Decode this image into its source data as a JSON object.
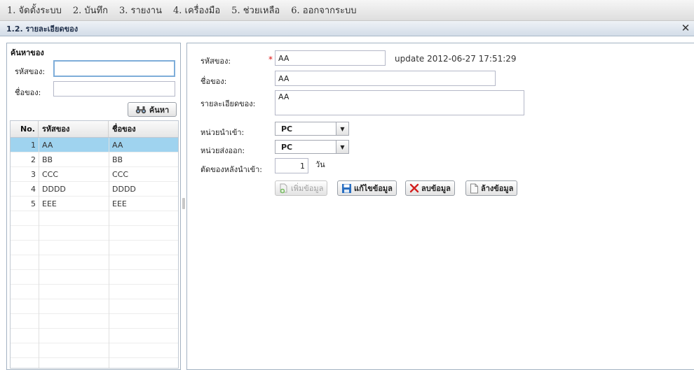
{
  "menu": {
    "items": [
      "1. จัดตั้งระบบ",
      "2. บันทึก",
      "3. รายงาน",
      "4. เครื่องมือ",
      "5. ช่วยเหลือ",
      "6. ออกจากระบบ"
    ]
  },
  "window": {
    "title": "1.2. รายละเอียดของ"
  },
  "search": {
    "title": "ค้นหาของ",
    "code_label": "รหัสของ:",
    "code_value": "",
    "name_label": "ชื่อของ:",
    "name_value": "",
    "button_label": "ค้นหา"
  },
  "grid": {
    "headers": {
      "no": "No.",
      "code": "รหัสของ",
      "name": "ชื่อของ"
    },
    "rows": [
      {
        "no": "1",
        "code": "AA",
        "name": "AA"
      },
      {
        "no": "2",
        "code": "BB",
        "name": "BB"
      },
      {
        "no": "3",
        "code": "CCC",
        "name": "CCC"
      },
      {
        "no": "4",
        "code": "DDDD",
        "name": "DDDD"
      },
      {
        "no": "5",
        "code": "EEE",
        "name": "EEE"
      }
    ],
    "selected_index": 0
  },
  "form": {
    "code_label": "รหัสของ:",
    "code_value": "AA",
    "update_text": "update 2012-06-27 17:51:29",
    "name_label": "ชื่อของ:",
    "name_value": "AA",
    "detail_label": "รายละเอียดของ:",
    "detail_value": "AA",
    "unit_in_label": "หน่วยนำเข้า:",
    "unit_in_value": "PC",
    "unit_out_label": "หน่วยส่งออก:",
    "unit_out_value": "PC",
    "days_label": "ตัดของหลังนำเข้า:",
    "days_value": "1",
    "days_unit": "วัน"
  },
  "buttons": {
    "add": "เพิ่มข้อมูล",
    "edit": "แก้ไขข้อมูล",
    "delete": "ลบข้อมูล",
    "clear": "ล้างข้อมูล"
  },
  "colors": {
    "selected_row": "#9fd3ef",
    "delete_icon": "#d22020",
    "save_icon": "#2a6fc1"
  }
}
